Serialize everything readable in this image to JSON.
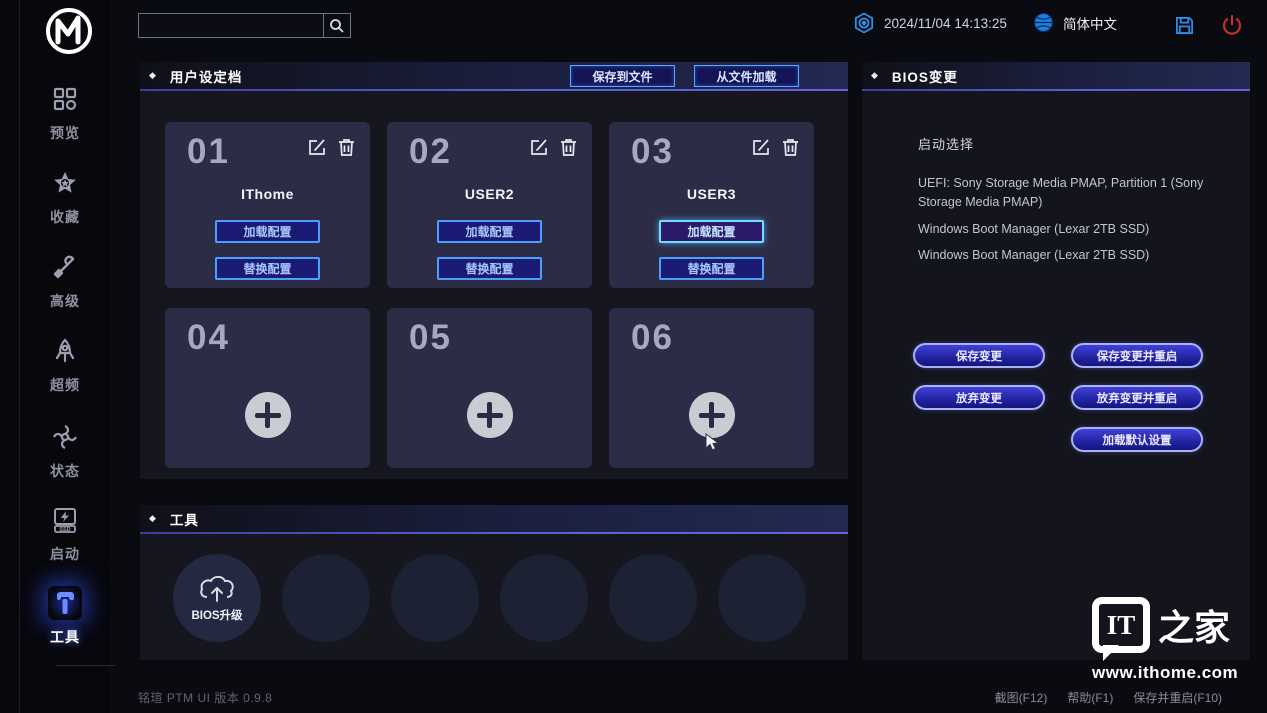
{
  "topbar": {
    "search_placeholder": "",
    "search_value": "",
    "datetime": "2024/11/04 14:13:25",
    "language": "简体中文"
  },
  "sidebar": {
    "items": [
      {
        "label": "预览",
        "icon": "grid-preview-icon"
      },
      {
        "label": "收藏",
        "icon": "star-favorites-icon"
      },
      {
        "label": "高级",
        "icon": "wrench-advanced-icon"
      },
      {
        "label": "超频",
        "icon": "rocket-overclock-icon"
      },
      {
        "label": "状态",
        "icon": "fan-status-icon"
      },
      {
        "label": "启动",
        "icon": "boot-ssd-icon"
      },
      {
        "label": "工具",
        "icon": "hammer-tools-icon"
      }
    ],
    "active_item": "工具"
  },
  "profiles": {
    "title": "用户设定档",
    "header_diamond": "◆",
    "save_to_file_label": "保存到文件",
    "load_from_file_label": "从文件加载",
    "load_config_label": "加载配置",
    "replace_config_label": "替换配置",
    "cards": [
      {
        "num": "01",
        "name": "IThome",
        "filled": true
      },
      {
        "num": "02",
        "name": "USER2",
        "filled": true
      },
      {
        "num": "03",
        "name": "USER3",
        "filled": true,
        "load_highlighted": true
      },
      {
        "num": "04",
        "filled": false
      },
      {
        "num": "05",
        "filled": false
      },
      {
        "num": "06",
        "filled": false
      }
    ]
  },
  "tools": {
    "title": "工具",
    "header_diamond": "◆",
    "first_item_label": "BIOS升级",
    "placeholder_slots": 5
  },
  "bios": {
    "title": "BIOS变更",
    "header_diamond": "◆",
    "boot_select_label": "启动选择",
    "boot_options": [
      "UEFI: Sony Storage Media PMAP, Partition 1 (Sony Storage Media PMAP)",
      "Windows Boot Manager (Lexar 2TB SSD)",
      "Windows Boot Manager (Lexar 2TB SSD)"
    ],
    "save_label": "保存变更",
    "save_restart_label": "保存变更并重启",
    "discard_label": "放弃变更",
    "discard_restart_label": "放弃变更并重启",
    "load_defaults_label": "加载默认设置"
  },
  "footer": {
    "version": "铭瑄 PTM UI 版本 0.9.8",
    "screenshot_label": "截图(F12)",
    "help_label": "帮助(F1)",
    "save_restart_label": "保存并重启(F10)"
  },
  "watermark": {
    "logo_it": "IT",
    "logo_home": "之家",
    "url": "www.ithome.com"
  },
  "colors": {
    "page_bg": "#0a0a11",
    "panel_bg": "#16161f",
    "card_bg": "#2c2c46",
    "accent_blue": "#2e8fe8",
    "active_glow": "#3a5bff",
    "power_red": "#c62f2f",
    "header_line": "#5a63d8",
    "config_button_border": "#4d9fff",
    "pill_button_border": "#aab2f2"
  }
}
